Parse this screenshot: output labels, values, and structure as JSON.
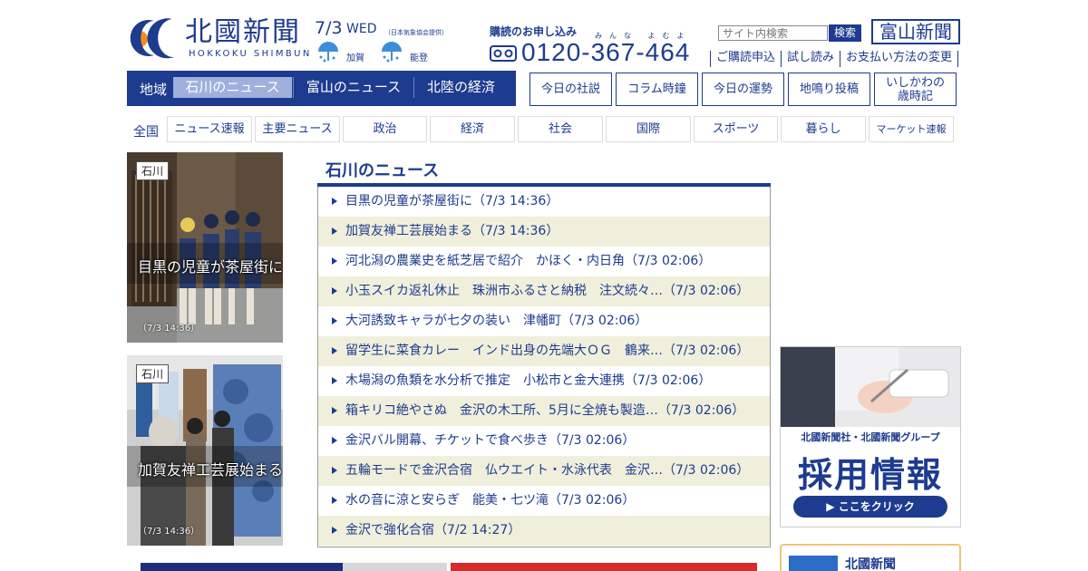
{
  "header": {
    "logo_title": "北國新聞",
    "logo_subtitle": "HOKKOKU SHIMBUN",
    "date": "7/3",
    "weekday": "WED",
    "weather_source": "（日本気象協会提供）",
    "weather": [
      {
        "region": "加賀",
        "icon": "rain-umbrella-icon"
      },
      {
        "region": "能登",
        "icon": "rain-umbrella-icon"
      }
    ],
    "subscribe_heading": "購読のお申し込み",
    "phone_ruby": "みんな よむよ",
    "phone_number": "0120-367-464",
    "search_placeholder": "サイト内検索",
    "search_button": "検索",
    "toyama_button": "富山新聞",
    "util_links": [
      "ご購読申込",
      "試し読み",
      "お支払い方法の変更"
    ]
  },
  "region_nav": {
    "label": "地域",
    "tabs": [
      "石川のニュース",
      "富山のニュース",
      "北陸の経済"
    ],
    "active": 0
  },
  "column_buttons": [
    "今日の社説",
    "コラム時鐘",
    "今日の運勢",
    "地鳴り投稿",
    "いしかわの 歳時記"
  ],
  "categories": {
    "all_label": "全国",
    "items": [
      "ニュース速報",
      "主要ニュース",
      "政治",
      "経済",
      "社会",
      "国際",
      "スポーツ",
      "暮らし",
      "マーケット速報"
    ]
  },
  "features": [
    {
      "tag": "石川",
      "caption": "目黒の児童が茶屋街に",
      "time": "（7/3 14:36）"
    },
    {
      "tag": "石川",
      "caption": "加賀友禅工芸展始まる",
      "time": "（7/3 14:36）"
    }
  ],
  "news": {
    "title": "石川のニュース",
    "items": [
      "目黒の児童が茶屋街に（7/3 14:36）",
      "加賀友禅工芸展始まる（7/3 14:36）",
      "河北潟の農業史を紙芝居で紹介　かほく・内日角（7/3 02:06）",
      "小玉スイカ返礼休止　珠洲市ふるさと納税　注文続々…（7/3 02:06）",
      "大河誘致キャラが七夕の装い　津幡町（7/3 02:06）",
      "留学生に菜食カレー　インド出身の先端大ＯＧ　鶴来…（7/3 02:06）",
      "木場潟の魚類を水分析で推定　小松市と金大連携（7/3 02:06）",
      "箱キリコ絶やさぬ　金沢の木工所、5月に全焼も製造…（7/3 02:06）",
      "金沢バル開幕、チケットで食べ歩き（7/3 02:06）",
      "五輪モードで金沢合宿　仏ウエイト・水泳代表　金沢…（7/3 02:06）",
      "水の音に涼と安らぎ　能美・七ツ滝（7/3 02:06）",
      "金沢で強化合宿（7/2 14:27）"
    ]
  },
  "recruit_banner": {
    "company": "北國新聞社・北國新聞グループ",
    "main": "採用情報",
    "cta": "▶ ここをクリック"
  },
  "bottom_card": {
    "label": "北國新聞"
  },
  "colors": {
    "brand": "#1d3b8f",
    "active_tab": "#9fb0dd",
    "alt_row": "#efefdc"
  }
}
